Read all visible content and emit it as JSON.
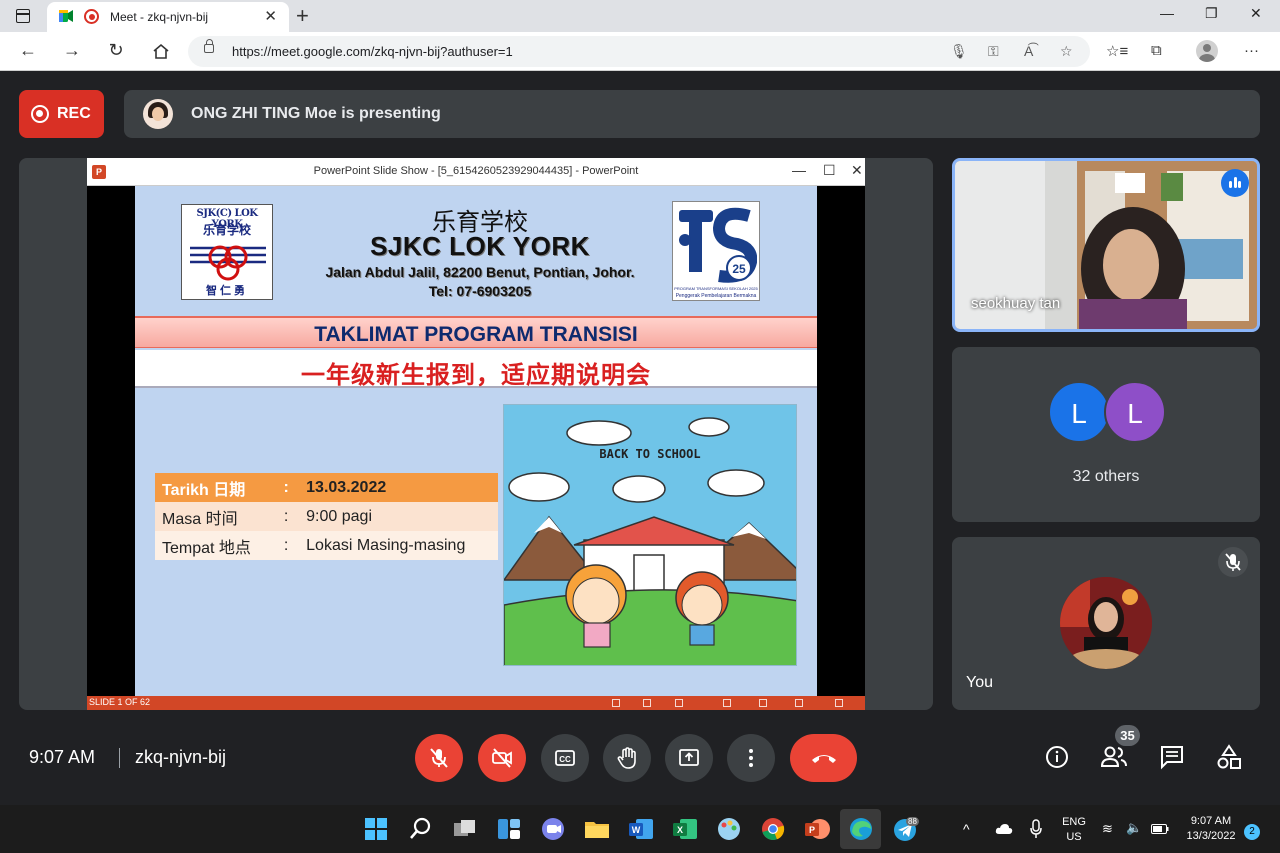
{
  "browser": {
    "tab_title": "Meet - zkq-njvn-bij",
    "url": "https://meet.google.com/zkq-njvn-bij?authuser=1"
  },
  "meet": {
    "rec_label": "REC",
    "presenting_text": "ONG ZHI TING Moe is presenting",
    "clock": "9:07 AM",
    "meeting_code": "zkq-njvn-bij",
    "people_count": "35",
    "colors": {
      "accent": "#8ab4f8",
      "red": "#ea4335",
      "surface": "#3c4043"
    }
  },
  "powerpoint": {
    "window_title": "PowerPoint Slide Show - [5_6154260523929044435] - PowerPoint",
    "status": "SLIDE 1 OF 62",
    "slide": {
      "logo_left_line1": "SJK(C) LOK YORK",
      "logo_left_line2": "乐育学校",
      "logo_left_line3": "智仁勇",
      "school_cn": "乐育学校",
      "school_en": "SJKC LOK YORK",
      "address": "Jalan Abdul Jalil, 82200 Benut, Pontian, Johor.",
      "tel": "Tel: 07-6903205",
      "logo_right_caption1": "PROGRAM TRANSFORMASI SEKOLAH 2025",
      "logo_right_caption2": "Penggerak Pembelajaran Bermakna",
      "banner_title": "TAKLIMAT PROGRAM TRANSISI",
      "banner_subtitle": "一年级新生报到，适应期说明会",
      "illustration_text": "BACK TO SCHOOL",
      "table": [
        {
          "label": "Tarikh 日期",
          "colon": ":",
          "value": "13.03.2022"
        },
        {
          "label": "Masa 时间",
          "colon": ":",
          "value": "9:00 pagi"
        },
        {
          "label": "Tempat 地点",
          "colon": ":",
          "value": "Lokasi Masing-masing"
        }
      ]
    }
  },
  "participants": {
    "speaker_name": "seokhuay tan",
    "avatar_1_letter": "L",
    "avatar_1_color": "#1a73e8",
    "avatar_2_letter": "L",
    "avatar_2_color": "#8e4fc8",
    "others_label": "32 others",
    "self_label": "You"
  },
  "taskbar": {
    "language_line1": "ENG",
    "language_line2": "US",
    "time": "9:07 AM",
    "date": "13/3/2022",
    "notification_count": "2",
    "telegram_badge": "88"
  }
}
